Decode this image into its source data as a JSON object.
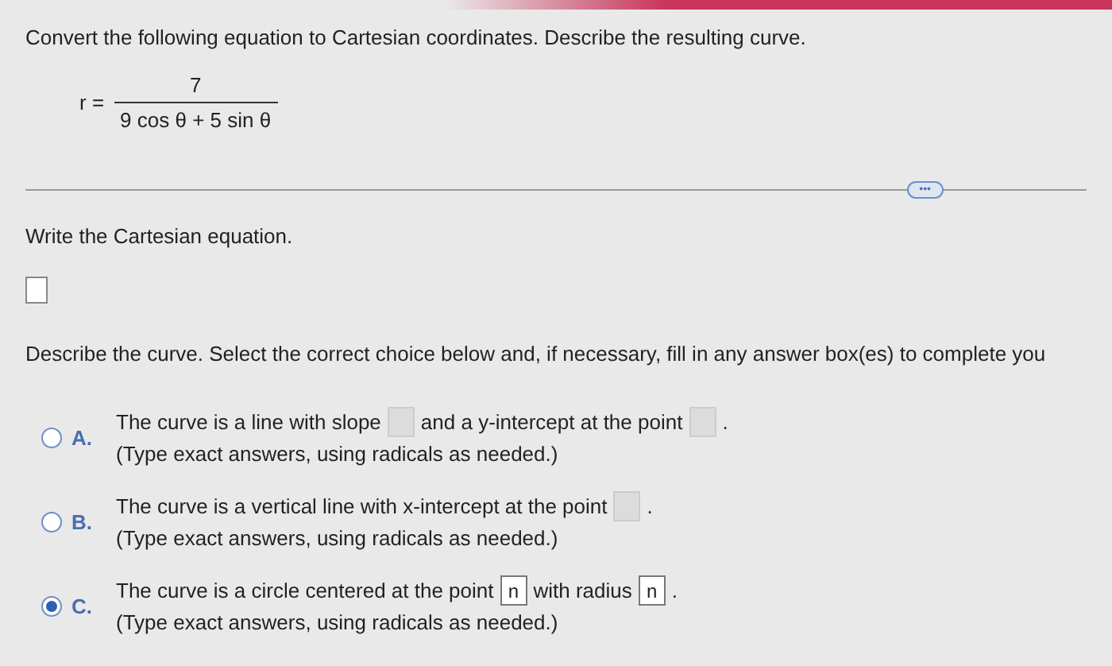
{
  "question": {
    "instruction": "Convert the following equation to Cartesian coordinates. Describe the resulting curve.",
    "equation": {
      "lhs": "r =",
      "numerator": "7",
      "denominator": "9 cos θ + 5 sin θ"
    }
  },
  "more_button": "•••",
  "part1": {
    "prompt": "Write the Cartesian equation."
  },
  "part2": {
    "prompt": "Describe the curve. Select the correct choice below and, if necessary, fill in any answer box(es) to complete you",
    "choices": [
      {
        "letter": "A.",
        "selected": false,
        "line": [
          {
            "kind": "text",
            "text": "The curve is a line with slope"
          },
          {
            "kind": "box",
            "disabled": true
          },
          {
            "kind": "text",
            "text": "and a y-intercept at the point"
          },
          {
            "kind": "box",
            "disabled": true
          },
          {
            "kind": "text",
            "text": "."
          }
        ],
        "note": "(Type exact answers, using radicals as needed.)"
      },
      {
        "letter": "B.",
        "selected": false,
        "line": [
          {
            "kind": "text",
            "text": "The curve is a vertical line with x-intercept at the point"
          },
          {
            "kind": "box",
            "disabled": true
          },
          {
            "kind": "text",
            "text": "."
          }
        ],
        "note": "(Type exact answers, using radicals as needed.)"
      },
      {
        "letter": "C.",
        "selected": true,
        "line": [
          {
            "kind": "text",
            "text": "The curve is a circle centered at the point"
          },
          {
            "kind": "box",
            "disabled": false,
            "value": "n"
          },
          {
            "kind": "text",
            "text": "with radius"
          },
          {
            "kind": "box",
            "disabled": false,
            "value": "n"
          },
          {
            "kind": "text",
            "text": "."
          }
        ],
        "note": "(Type exact answers, using radicals as needed.)"
      }
    ]
  }
}
